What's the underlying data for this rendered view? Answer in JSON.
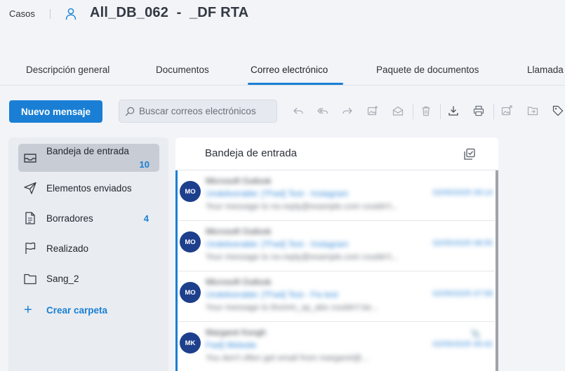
{
  "header": {
    "breadcrumb": "Casos",
    "case_title": "All_DB_062  -  _DF RTA"
  },
  "tabs": [
    {
      "label": "Descripción general",
      "active": false
    },
    {
      "label": "Documentos",
      "active": false
    },
    {
      "label": "Correo electrónico",
      "active": true
    },
    {
      "label": "Paquete de documentos",
      "active": false
    },
    {
      "label": "Llamada",
      "active": false
    }
  ],
  "toolbar": {
    "new_message_label": "Nuevo mensaje",
    "search_placeholder": "Buscar correos electrónicos",
    "icons": [
      "reply-icon",
      "reply-all-icon",
      "forward-icon",
      "image-add-icon",
      "mark-read-icon",
      "delete-icon",
      "download-icon",
      "print-icon",
      "image-share-icon",
      "move-folder-icon",
      "tag-icon"
    ]
  },
  "folders": [
    {
      "label": "Bandeja de entrada",
      "count": "10",
      "icon": "inbox-icon",
      "active": true
    },
    {
      "label": "Elementos enviados",
      "count": "",
      "icon": "send-icon",
      "active": false
    },
    {
      "label": "Borradores",
      "count": "4",
      "icon": "draft-icon",
      "active": false
    },
    {
      "label": "Realizado",
      "count": "",
      "icon": "flag-icon",
      "active": false
    },
    {
      "label": "Sang_2",
      "count": "",
      "icon": "folder-icon",
      "active": false
    }
  ],
  "create_folder_label": "Crear carpeta",
  "message_list": {
    "title": "Bandeja de entrada",
    "messages": [
      {
        "initials": "MO",
        "sender": "Microsoft Outlook",
        "subject": "Undeliverable: [*Fwd] Test - Instagram",
        "preview": "Your message to no-reply@example.com couldn't...",
        "date": "02/05/2025 09:14"
      },
      {
        "initials": "MO",
        "sender": "Microsoft Outlook",
        "subject": "Undeliverable: [*Fwd] Test - Instagram",
        "preview": "Your message to no-reply@example.com couldn't...",
        "date": "02/05/2025 08:55"
      },
      {
        "initials": "MO",
        "sender": "Microsoft Outlook",
        "subject": "Undeliverable: [*Fwd] Test - Fw test",
        "preview": "Your message to thomm_sp_abs couldn't be...",
        "date": "02/05/2025 07:58"
      },
      {
        "initials": "MK",
        "sender": "Margaret Keogh",
        "subject": "Fwd] Website",
        "preview": "You don't often get email from margaret@...",
        "date": "02/05/2025 06:42"
      }
    ]
  }
}
